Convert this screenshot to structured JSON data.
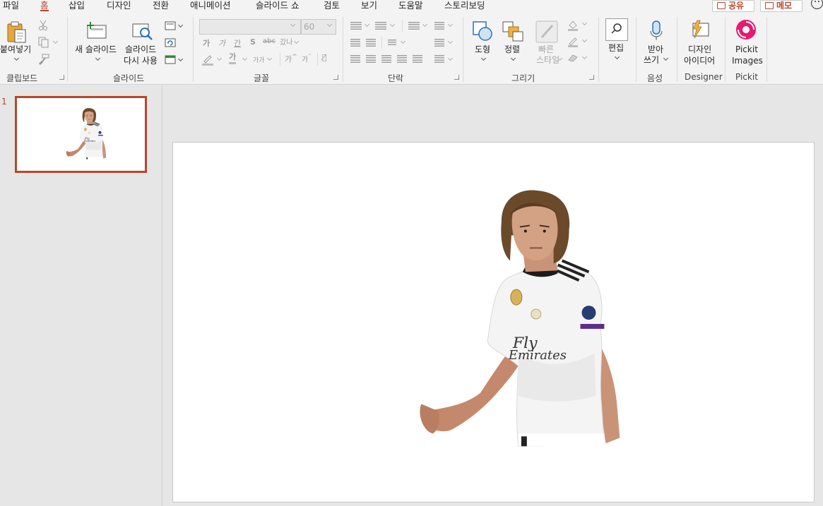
{
  "menu": {
    "tabs": [
      "파일",
      "홈",
      "삽입",
      "디자인",
      "전환",
      "애니메이션",
      "슬라이드 쇼",
      "검토",
      "보기",
      "도움말",
      "스토리보딩"
    ],
    "active_tab": "홈",
    "share_label": "공유",
    "comment_label": "메모"
  },
  "ribbon": {
    "clipboard": {
      "paste_label": "붙여넣기",
      "group_label": "클립보드"
    },
    "slides": {
      "new_slide_label": "새 슬라이드",
      "reuse_label_1": "슬라이드",
      "reuse_label_2": "다시 사용",
      "group_label": "슬라이드"
    },
    "font": {
      "font_name_value": "",
      "font_size_value": "60",
      "group_label": "글꼴"
    },
    "paragraph": {
      "group_label": "단락"
    },
    "drawing": {
      "shapes_label": "도형",
      "arrange_label": "정렬",
      "quick_styles_label_1": "빠른",
      "quick_styles_label_2": "스타일",
      "group_label": "그리기"
    },
    "editing": {
      "label": "편집"
    },
    "voice": {
      "dictate_label_1": "받아",
      "dictate_label_2": "쓰기",
      "group_label": "음성"
    },
    "designer": {
      "label_1": "디자인",
      "label_2": "아이디어",
      "group_label": "Designer"
    },
    "pickit": {
      "label_1": "Pickit",
      "label_2": "Images",
      "group_label": "Pickit"
    }
  },
  "thumbnails": [
    {
      "number": "1"
    }
  ],
  "colors": {
    "accent": "#b7472a",
    "ribbon_bg": "#f3f3f3",
    "workspace_bg": "#e6e6e6",
    "pickit": "#e8196e"
  }
}
